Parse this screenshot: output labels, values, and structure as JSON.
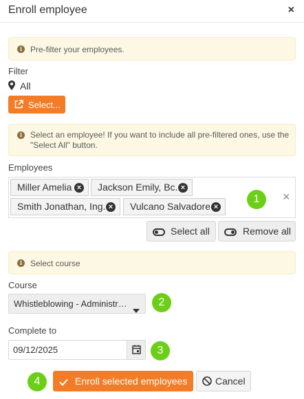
{
  "dialog": {
    "title": "Enroll employee",
    "close_glyph": "×"
  },
  "notices": {
    "prefilter": "Pre-filter your employees.",
    "select_employee": "Select an employee! If you want to include all pre-filtered ones, use the \"Select All\" button.",
    "select_course": "Select course"
  },
  "filter": {
    "label": "Filter",
    "value": "All",
    "select_button": "Select..."
  },
  "employees": {
    "label": "Employees",
    "selected": [
      "Miller Amelia",
      "Jackson Emily, Bc.",
      "Smith Jonathan, Ing.",
      "Vulcano Salvadore"
    ],
    "select_all": "Select all",
    "remove_all": "Remove all"
  },
  "course": {
    "label": "Course",
    "value": "Whistleblowing - Administr…"
  },
  "complete_to": {
    "label": "Complete to",
    "value": "09/12/2025"
  },
  "actions": {
    "enroll": "Enroll selected employees",
    "cancel": "Cancel"
  },
  "steps": [
    "1",
    "2",
    "3",
    "4"
  ],
  "colors": {
    "accent": "#f47c26",
    "step": "#6ccf17",
    "notice_bg": "#fcf8e3"
  },
  "icons": [
    "map-marker-icon",
    "external-link-icon",
    "info-icon",
    "remove-tag-icon",
    "clear-icon",
    "toggle-on-icon",
    "toggle-off-icon",
    "caret-down-icon",
    "calendar-icon",
    "check-icon",
    "cancel-icon"
  ]
}
